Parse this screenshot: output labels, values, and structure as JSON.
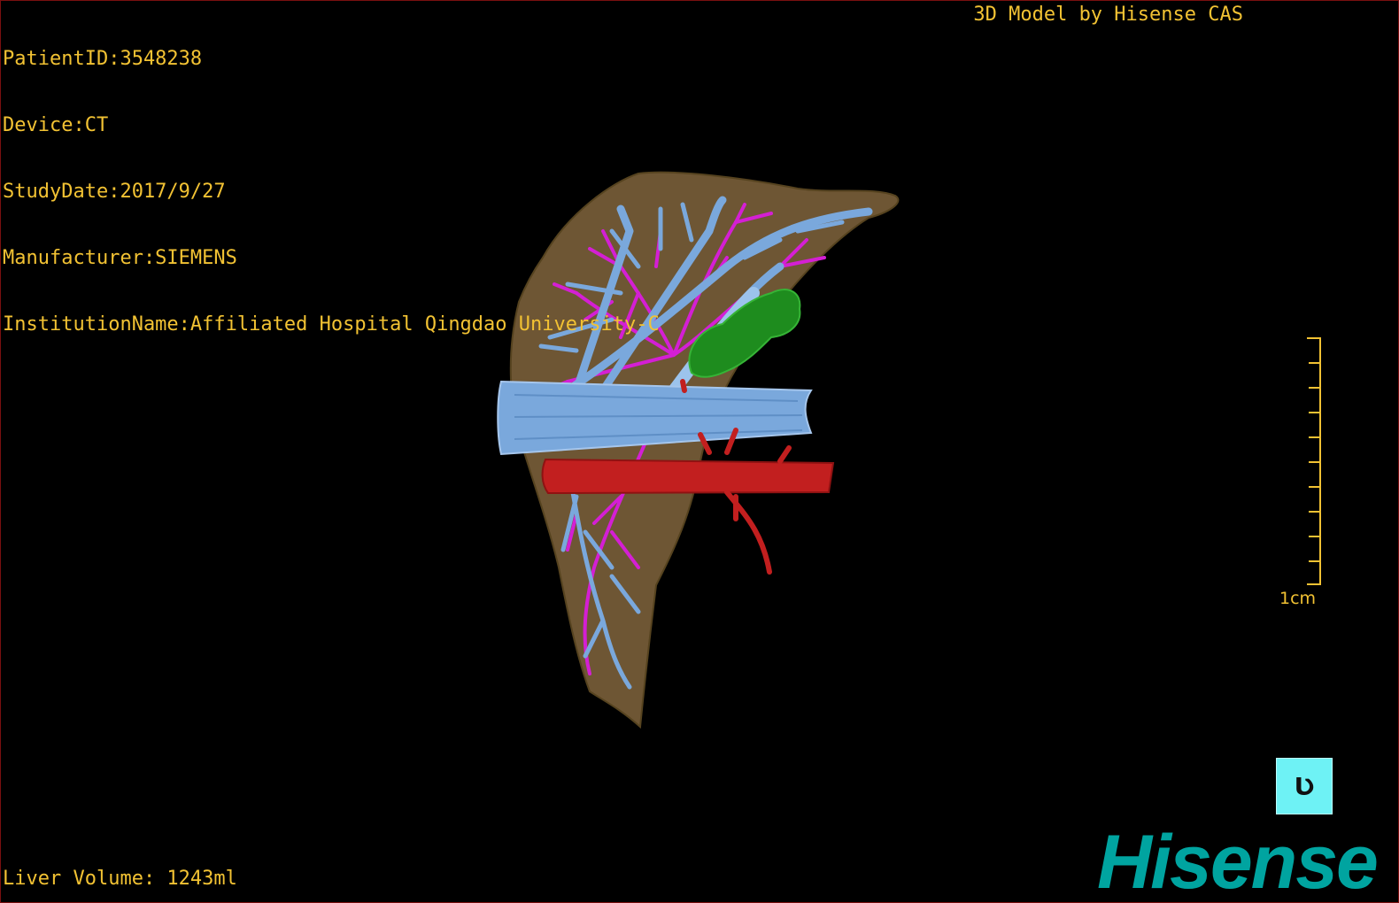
{
  "header": {
    "patient_id": "PatientID:3548238",
    "device": "Device:CT",
    "study_date": "StudyDate:2017/9/27",
    "manufacturer": "Manufacturer:SIEMENS",
    "institution": "InstitutionName:Affiliated Hospital Qingdao University-C",
    "model_credit": "3D Model by Hisense CAS"
  },
  "footer": {
    "liver_volume": "Liver Volume: 1243ml"
  },
  "scale_bar": {
    "label": "1cm",
    "tick_count": 11
  },
  "orientation_cube": {
    "face_label": "Ʋ"
  },
  "logo": {
    "text": "Hisense"
  },
  "colors": {
    "overlay_text": "#f2c233",
    "liver": "#6e5634",
    "hepatic_vein": "#7aa8dc",
    "portal_vein": "#c21f1f",
    "arteries": "#d41fd4",
    "lesion": "#1e8c1e",
    "logo": "#00a4a0",
    "orientation_cube": "#6ef2f5"
  }
}
